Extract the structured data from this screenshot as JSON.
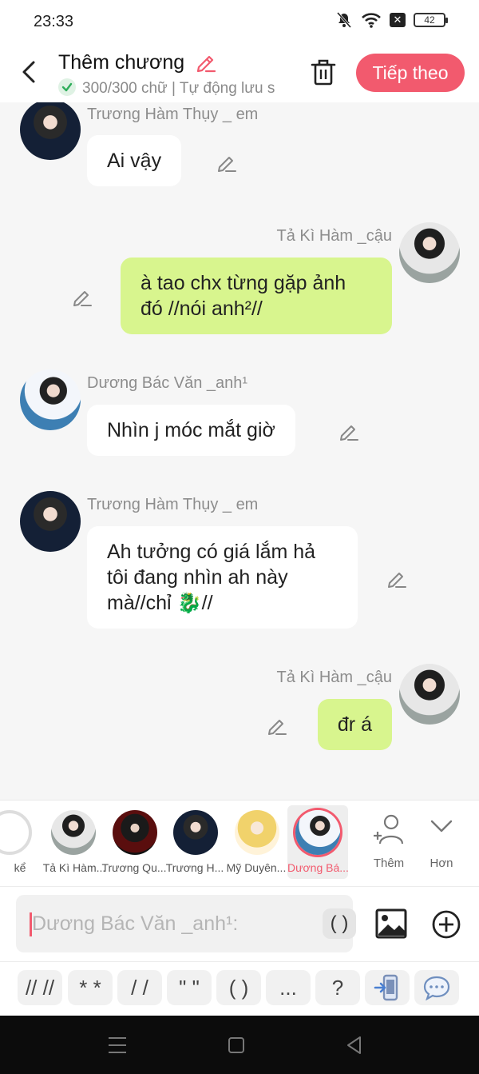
{
  "status": {
    "time": "23:33",
    "battery": "42"
  },
  "header": {
    "title": "Thêm chương",
    "subtitle": "300/300 chữ | Tự động lưu s",
    "next_label": "Tiếp theo"
  },
  "messages": [
    {
      "name": "Trương Hàm Thụy _ em",
      "lines": [
        "Ai vậy"
      ]
    },
    {
      "name": "Tả Kì Hàm _cậu",
      "lines": [
        "à tao chx từng gặp ảnh",
        "đó //nói anh²//"
      ]
    },
    {
      "name": "Dương Bác Văn _anh¹",
      "lines": [
        "Nhìn j móc mắt giờ"
      ]
    },
    {
      "name": "Trương Hàm Thụy _ em",
      "lines": [
        "Ah tưởng có giá lắm hả",
        "tôi đang nhìn ah này",
        "mà//chỉ 🐉//"
      ]
    },
    {
      "name": "Tả Kì Hàm _cậu",
      "lines": [
        "đr á"
      ]
    }
  ],
  "characters": [
    {
      "label": "kể"
    },
    {
      "label": "Tả Kì Hàm..."
    },
    {
      "label": "Trương Qu..."
    },
    {
      "label": "Trương H..."
    },
    {
      "label": "Mỹ Duyên..."
    },
    {
      "label": "Dương Bá..."
    }
  ],
  "more_buttons": {
    "add": "Thêm",
    "more": "Hơn"
  },
  "input": {
    "placeholder": "Dương Bác Văn _anh¹:",
    "paren": "( )"
  },
  "symbols": [
    "// //",
    "* *",
    "/ /",
    "\" \"",
    "( )",
    "...",
    "?"
  ],
  "colors": {
    "accent": "#f25a6e",
    "bubble_green": "#d8f58e"
  }
}
